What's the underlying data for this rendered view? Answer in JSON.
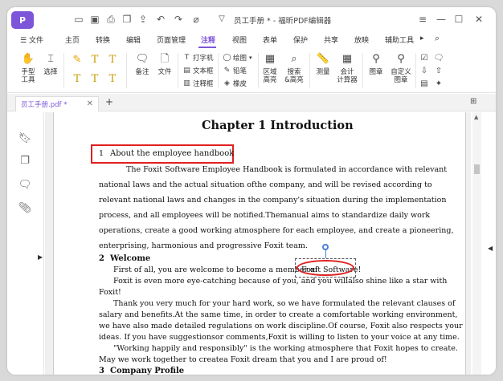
{
  "app": {
    "logo_text": "P",
    "document_title": "员工手册 * - 福昕PDF编辑器",
    "brand_color": "#7d55d9"
  },
  "menu": {
    "file": "文件",
    "tabs": [
      "主页",
      "转换",
      "编辑",
      "页面管理",
      "注释",
      "视图",
      "表单",
      "保护",
      "共享",
      "放映",
      "辅助工具"
    ],
    "active": "注释"
  },
  "ribbon": {
    "hand_tool": "手型\n工具",
    "select": "选择",
    "note": "备注",
    "file": "文件",
    "typewriter": "打字机",
    "textbox": "文本框",
    "callout": "注释框",
    "drawing": "绘图",
    "pencil": "铅笔",
    "eraser": "橡皮",
    "area_highlight": "区域\n高亮",
    "search_highlight": "搜索\n&高亮",
    "measure": "测量",
    "cumulative_calc": "会计\n计算器",
    "stamp": "图章",
    "custom_stamp": "自定义\n图章"
  },
  "tabs": {
    "doc_tab_label": "员工手册.pdf *",
    "add_tab": "+"
  },
  "document": {
    "chapter_title": "Chapter 1 Introduction",
    "sec1_num": "1",
    "sec1_title": "About the employee handbook",
    "sec1_lines": [
      "The Foxit Software Employee Handbook is formulated in accordance with relevant",
      "national laws and the actual situation ofthe company, and will be revised according to",
      "relevant national laws and changes in the company's situation during the implementation",
      "process, and all employees will be notified.Themanual aims to standardize daily work",
      "operations, create a good working atmosphere for each employee, and create a pioneering,",
      "enterprising, harmonious and progressive Foxit team."
    ],
    "sec2_num": "2",
    "sec2_title": "Welcome",
    "sec2_line1_a": "First of all, you are welcome to become a member of",
    "sec2_line1_b": "Foxit Software!",
    "sec2_lines": [
      "Foxit is even more eye-catching because of you, and you willalso shine like a star with",
      "Foxit!",
      "Thank you very much for your hard work, so we have formulated the relevant clauses of",
      "salary and benefits.At the same time, in order to create a comfortable working environment,",
      "we have also made detailed regulations on work discipline.Of course, Foxit also respects your",
      "ideas. If you have suggestionsor comments,Foxit is willing to listen to your voice at any time.",
      "\"Working happily and responsibly\" is the working atmosphere that Foxit hopes to create.",
      "May we work together to createa Foxit dream that you and I are proud of!"
    ],
    "sec3_num": "3",
    "sec3_title": "Company Profile"
  }
}
